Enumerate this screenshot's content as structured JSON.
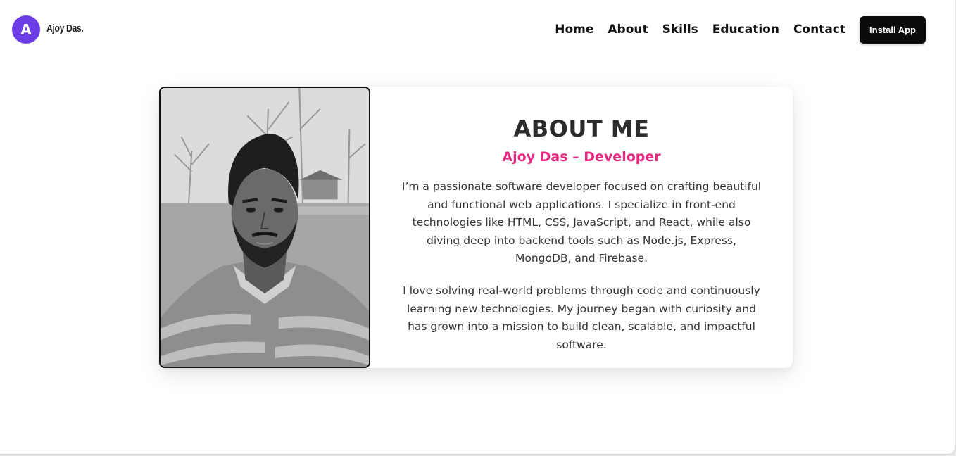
{
  "header": {
    "logo_letter": "A",
    "logo_name": "Ajoy Das.",
    "nav": [
      "Home",
      "About",
      "Skills",
      "Education",
      "Contact"
    ],
    "install_label": "Install App"
  },
  "about": {
    "title": "ABOUT ME",
    "subtitle": "Ajoy Das – Developer",
    "paragraphs": [
      "I’m a passionate software developer focused on crafting beautiful and functional web applications. I specialize in front-end technologies like HTML, CSS, JavaScript, and React, while also diving deep into backend tools such as Node.js, Express, MongoDB, and Firebase.",
      "I love solving real-world problems through code and continuously learning new technologies. My journey began with curiosity and has grown into a mission to build clean, scalable, and impactful software."
    ]
  },
  "colors": {
    "brand_purple": "#6c3ce6",
    "accent_pink": "#e5277f",
    "button_black": "#0b0b0b"
  }
}
